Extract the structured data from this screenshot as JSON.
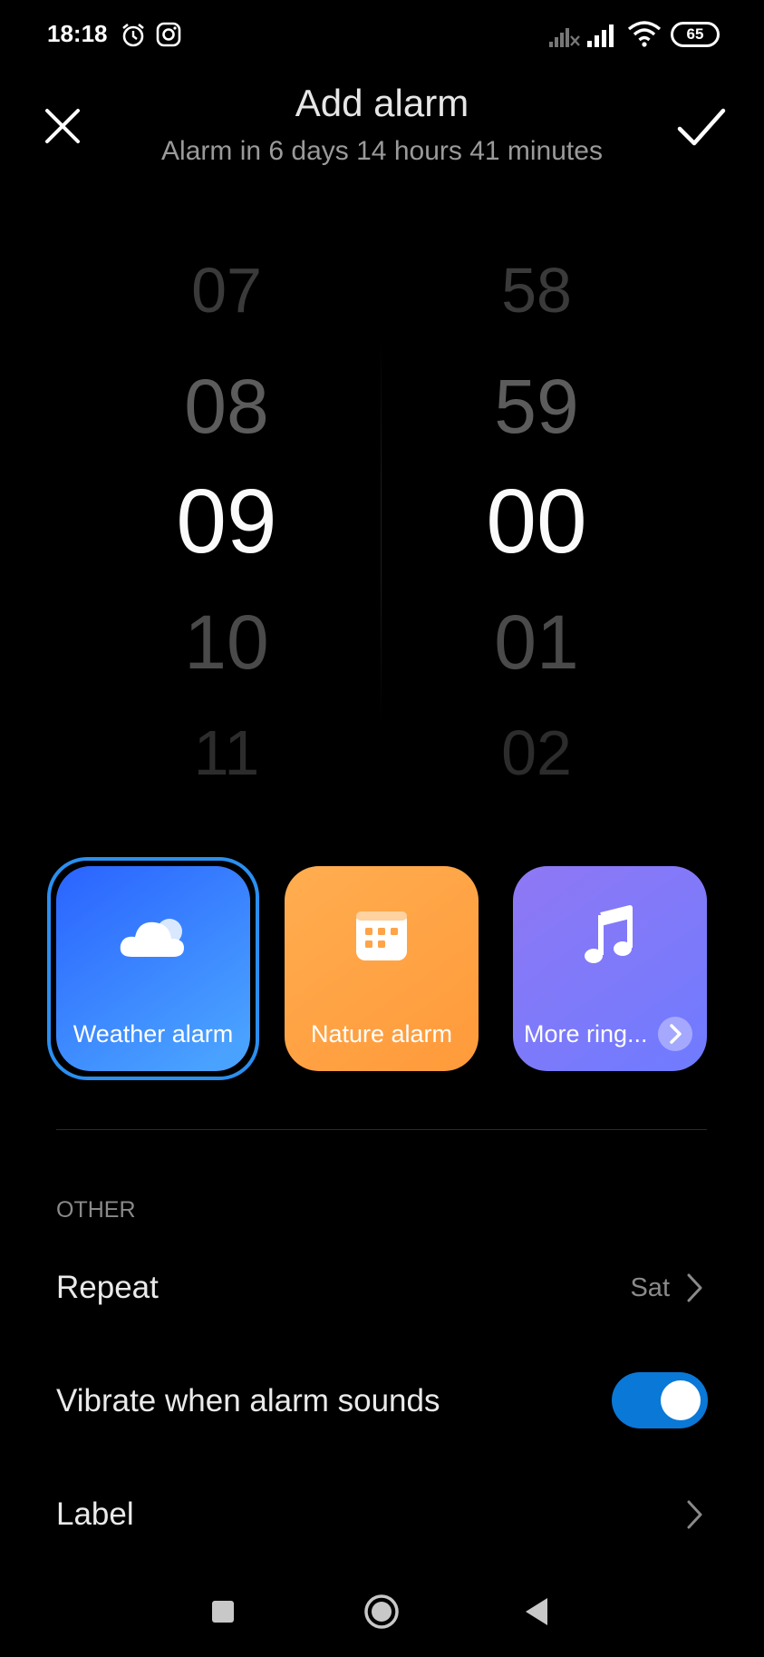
{
  "status_bar": {
    "time": "18:18",
    "battery": "65"
  },
  "header": {
    "title": "Add alarm",
    "subtitle": "Alarm in 6 days 14 hours 41 minutes"
  },
  "picker": {
    "hours": [
      "07",
      "08",
      "09",
      "10",
      "11"
    ],
    "minutes": [
      "58",
      "59",
      "00",
      "01",
      "02"
    ],
    "selected_hour": "09",
    "selected_minute": "00"
  },
  "ringtones": {
    "weather": "Weather alarm",
    "nature": "Nature alarm",
    "more": "More ring..."
  },
  "section": {
    "other_label": "OTHER"
  },
  "settings": {
    "repeat_label": "Repeat",
    "repeat_value": "Sat",
    "vibrate_label": "Vibrate when alarm sounds",
    "vibrate_on": true,
    "label_label": "Label"
  },
  "colors": {
    "accent_blue": "#0a78d7",
    "weather_tile": "#3a80ff",
    "nature_tile": "#ffa447",
    "more_tile": "#7f7af8"
  }
}
